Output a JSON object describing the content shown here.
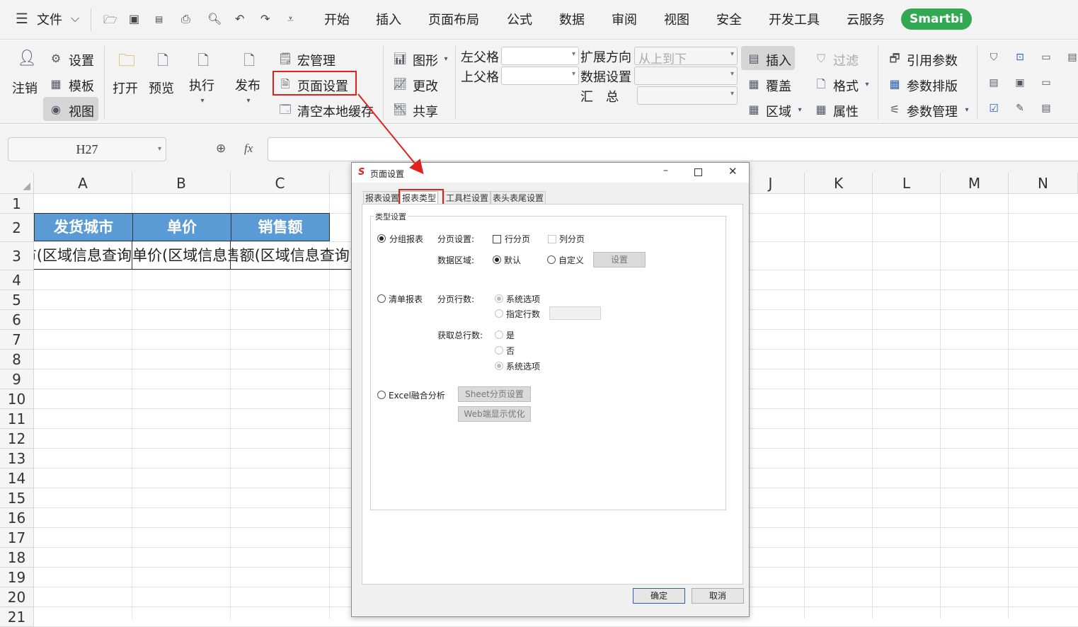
{
  "menubar": {
    "file_label": "文件",
    "tabs": [
      "开始",
      "插入",
      "页面布局",
      "公式",
      "数据",
      "审阅",
      "视图",
      "安全",
      "开发工具",
      "云服务"
    ],
    "smartbi": "Smartbi"
  },
  "ribbon": {
    "logout": "注销",
    "settings": "设置",
    "template": "模板",
    "view": "视图",
    "open": "打开",
    "preview": "预览",
    "execute": "执行",
    "publish": "发布",
    "macro": "宏管理",
    "page_setup": "页面设置",
    "clear_cache": "清空本地缓存",
    "chart": "图形",
    "modify": "更改",
    "share": "共享",
    "left_parent": "左父格",
    "top_parent": "上父格",
    "expand_dir": "扩展方向",
    "expand_value": "从上到下",
    "data_setting": "数据设置",
    "summary": "汇　总",
    "insert": "插入",
    "cover": "覆盖",
    "region": "区域",
    "filter": "过滤",
    "format": "格式",
    "property": "属性",
    "ref_param": "引用参数",
    "param_layout": "参数排版",
    "param_manage": "参数管理"
  },
  "formula": {
    "cell_ref": "H27",
    "fx": "fx"
  },
  "sheet": {
    "columns_left": [
      "A",
      "B",
      "C"
    ],
    "columns_right": [
      "J",
      "K",
      "L",
      "M",
      "N"
    ],
    "rows": [
      "1",
      "2",
      "3",
      "4",
      "5",
      "6",
      "7",
      "8",
      "9",
      "10",
      "11",
      "12",
      "13",
      "14",
      "15",
      "16",
      "17",
      "18",
      "19",
      "20",
      "21"
    ],
    "headers": [
      "发货城市",
      "单价",
      "销售额"
    ],
    "row3": [
      "发货城市(区域信息查询",
      "单价(区域信息查询",
      "销售额(区域信息查询)"
    ]
  },
  "dialog": {
    "title": "页面设置",
    "tabs": [
      "报表设置",
      "报表类型",
      "工具栏设置",
      "表头表尾设置"
    ],
    "group_title": "类型设置",
    "group_report": "分组报表",
    "page_setting": "分页设置:",
    "row_page": "行分页",
    "col_page": "列分页",
    "data_area": "数据区域:",
    "default": "默认",
    "custom": "自定义",
    "setting_btn": "设置",
    "list_report": "清单报表",
    "page_rows": "分页行数:",
    "sys_option": "系统选项",
    "specify_rows": "指定行数",
    "get_total": "获取总行数:",
    "yes": "是",
    "no": "否",
    "sys_option2": "系统选项",
    "excel_merge": "Excel融合分析",
    "sheet_page": "Sheet分页设置",
    "web_opt": "Web端显示优化",
    "ok": "确定",
    "cancel": "取消"
  },
  "colors": {
    "header_fill": "#5b9bd5",
    "smartbi_green": "#33a853",
    "highlight_red": "#e0221f"
  }
}
